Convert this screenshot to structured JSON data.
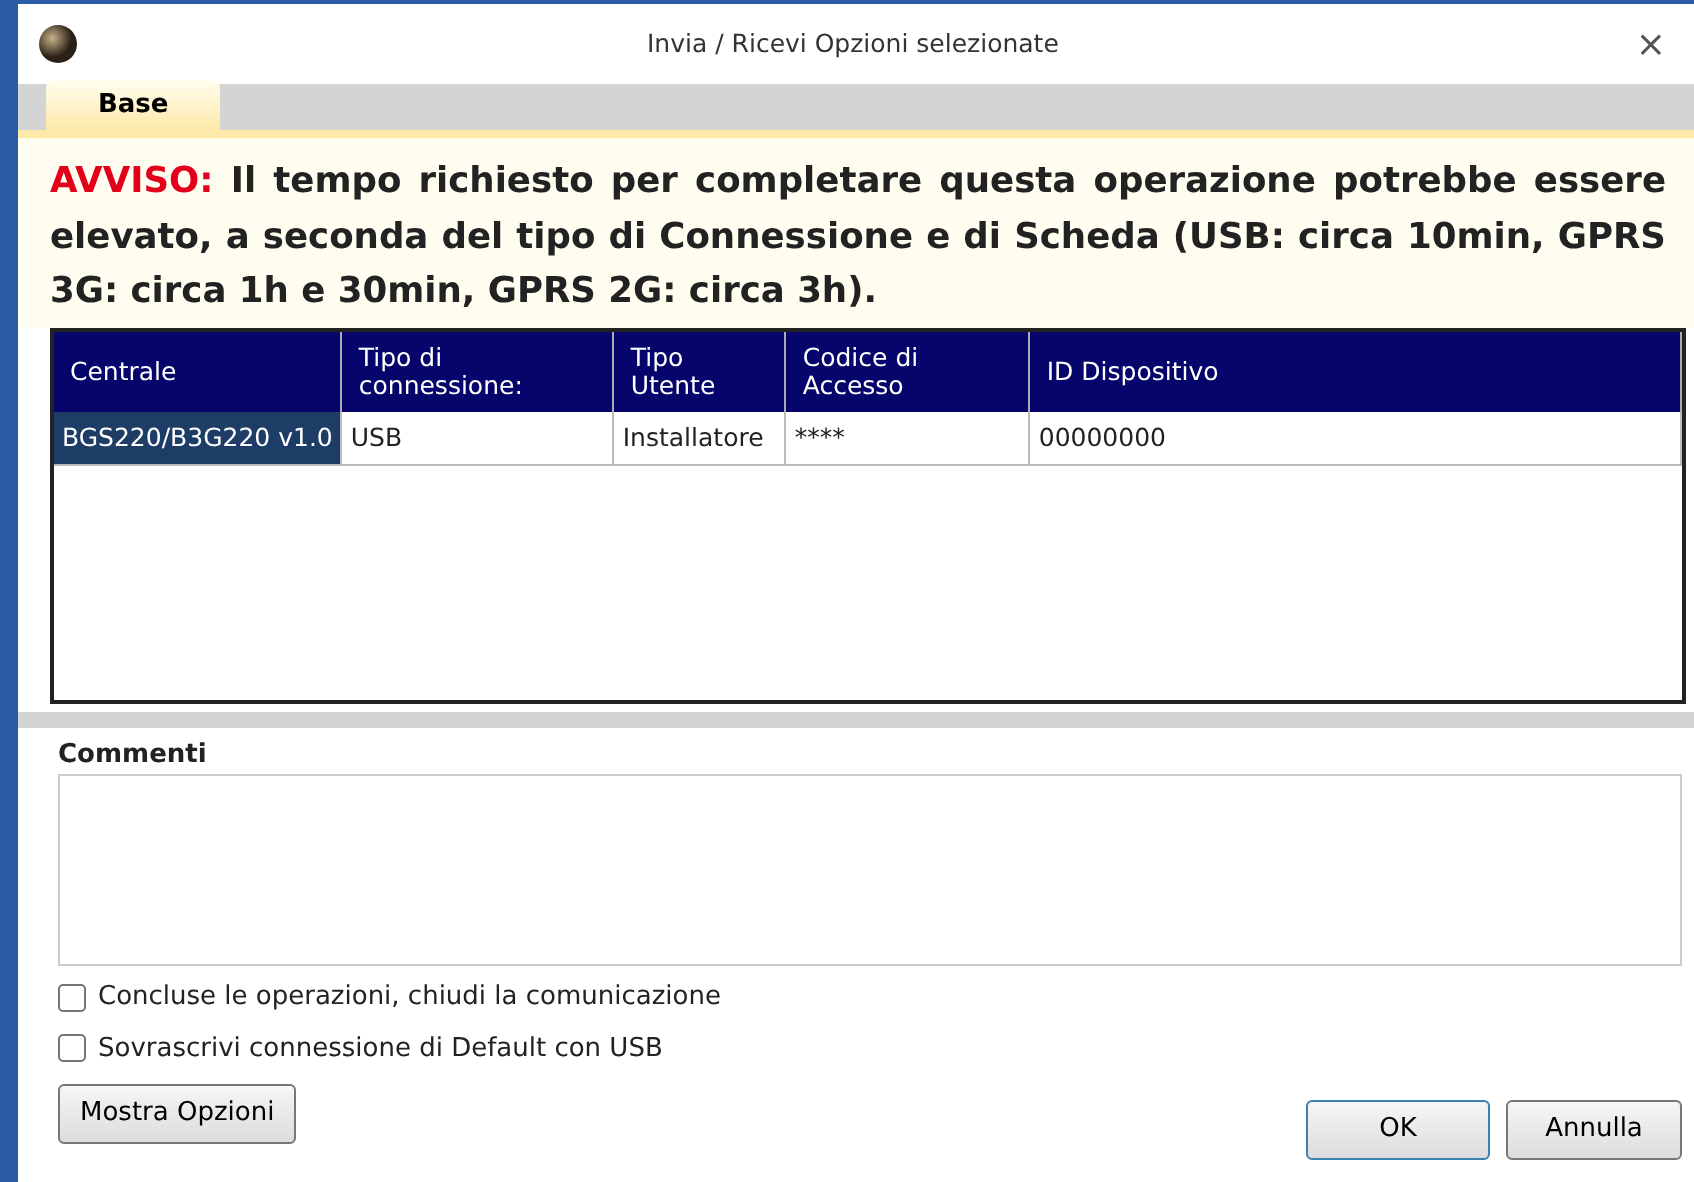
{
  "window": {
    "title": "Invia / Ricevi Opzioni selezionate",
    "close": "×"
  },
  "tabs": [
    {
      "label": "Base",
      "selected": true
    }
  ],
  "warning": {
    "label": "AVVISO:",
    "text": "Il tempo richiesto per completare questa operazione potrebbe essere elevato, a seconda del tipo di Connessione e di Scheda (USB: circa 10min, GPRS 3G: circa 1h e 30min, GPRS 2G: circa 3h)."
  },
  "table": {
    "columns": [
      "Centrale",
      "Tipo di connessione:",
      "Tipo Utente",
      "Codice di Accesso",
      "ID Dispositivo"
    ],
    "rows": [
      {
        "cells": [
          "BGS220/B3G220 v1.0",
          "USB",
          "Installatore",
          "****",
          "00000000"
        ],
        "selected": true
      }
    ]
  },
  "comments": {
    "label": "Commenti"
  },
  "checkboxes": [
    {
      "label": "Concluse le operazioni, chiudi la comunicazione",
      "checked": false
    },
    {
      "label": "Sovrascrivi connessione di Default con USB",
      "checked": false
    }
  ],
  "buttons": {
    "options": "Mostra Opzioni",
    "ok": "OK",
    "cancel": "Annulla"
  }
}
